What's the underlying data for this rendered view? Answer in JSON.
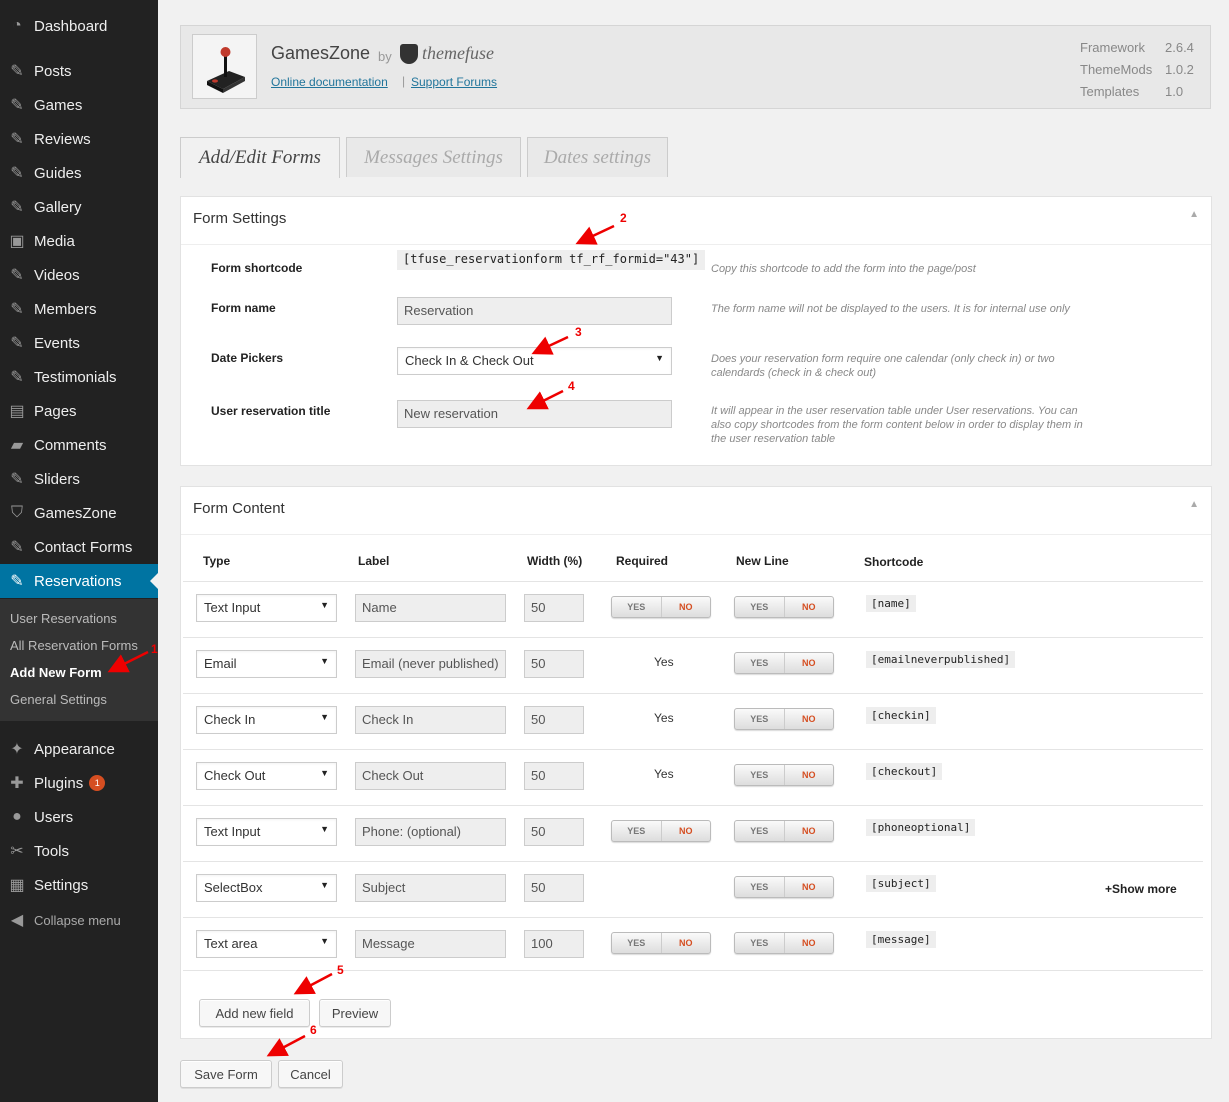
{
  "sidebar": {
    "items": [
      {
        "label": "Dashboard",
        "icon": "dashboard-icon",
        "glyph": "◔"
      },
      {
        "label": "Posts",
        "icon": "pin-icon",
        "glyph": "✎"
      },
      {
        "label": "Games",
        "icon": "pin-icon",
        "glyph": "✎"
      },
      {
        "label": "Reviews",
        "icon": "pin-icon",
        "glyph": "✎"
      },
      {
        "label": "Guides",
        "icon": "pin-icon",
        "glyph": "✎"
      },
      {
        "label": "Gallery",
        "icon": "pin-icon",
        "glyph": "✎"
      },
      {
        "label": "Media",
        "icon": "media-icon",
        "glyph": "▣"
      },
      {
        "label": "Videos",
        "icon": "pin-icon",
        "glyph": "✎"
      },
      {
        "label": "Members",
        "icon": "pin-icon",
        "glyph": "✎"
      },
      {
        "label": "Events",
        "icon": "pin-icon",
        "glyph": "✎"
      },
      {
        "label": "Testimonials",
        "icon": "pin-icon",
        "glyph": "✎"
      },
      {
        "label": "Pages",
        "icon": "pages-icon",
        "glyph": "▤"
      },
      {
        "label": "Comments",
        "icon": "comment-icon",
        "glyph": "▰"
      },
      {
        "label": "Sliders",
        "icon": "pin-icon",
        "glyph": "✎"
      },
      {
        "label": "GamesZone",
        "icon": "shield-icon",
        "glyph": "⛉"
      },
      {
        "label": "Contact Forms",
        "icon": "pin-icon",
        "glyph": "✎"
      },
      {
        "label": "Reservations",
        "icon": "pin-icon",
        "glyph": "✎"
      }
    ],
    "submenu": [
      {
        "label": "User Reservations"
      },
      {
        "label": "All Reservation Forms"
      },
      {
        "label": "Add New Form"
      },
      {
        "label": "General Settings"
      }
    ],
    "bottom_items": [
      {
        "label": "Appearance",
        "icon": "appearance-icon",
        "glyph": "✦"
      },
      {
        "label": "Plugins",
        "icon": "plugin-icon",
        "glyph": "✚",
        "badge": "1"
      },
      {
        "label": "Users",
        "icon": "user-icon",
        "glyph": "●"
      },
      {
        "label": "Tools",
        "icon": "wrench-icon",
        "glyph": "✂"
      },
      {
        "label": "Settings",
        "icon": "settings-icon",
        "glyph": "▦"
      }
    ],
    "collapse_label": "Collapse menu"
  },
  "header": {
    "app_title": "GamesZone",
    "by": "by",
    "brand": "themefuse",
    "link_docs": "Online documentation",
    "separator": "|",
    "link_forums": "Support Forums",
    "versions": [
      {
        "label": "Framework",
        "value": "2.6.4"
      },
      {
        "label": "ThemeMods",
        "value": "1.0.2"
      },
      {
        "label": "Templates",
        "value": "1.0"
      }
    ]
  },
  "tabs": [
    {
      "label": "Add/Edit Forms"
    },
    {
      "label": "Messages Settings"
    },
    {
      "label": "Dates settings"
    }
  ],
  "form_settings": {
    "title": "Form Settings",
    "toggle": "▲",
    "shortcode_label": "Form shortcode",
    "shortcode_value": "[tfuse_reservationform tf_rf_formid=\"43\"]",
    "shortcode_help": "Copy this shortcode to add the form into the page/post",
    "name_label": "Form name",
    "name_value": "Reservation",
    "name_help": "The form name will not be displayed to the users. It is for internal use only",
    "date_label": "Date Pickers",
    "date_value": "Check In & Check Out",
    "date_help": "Does your reservation form require one calendar (only check in) or two calendards (check in & check out)",
    "title_label": "User reservation title",
    "title_value": "New reservation",
    "title_help": "It will appear in the user reservation table under User reservations. You can also copy shortcodes from the form content below in order to display them in the user reservation table"
  },
  "form_content": {
    "title": "Form Content",
    "toggle": "▲",
    "headers": {
      "type": "Type",
      "label": "Label",
      "width": "Width (%)",
      "required": "Required",
      "newline": "New Line",
      "shortcode": "Shortcode"
    },
    "toggle_yes": "YES",
    "toggle_no": "NO",
    "rows": [
      {
        "type": "Text Input",
        "label": "Name",
        "width": "50",
        "required": "toggle",
        "shortcode": "[name]"
      },
      {
        "type": "Email",
        "label": "Email (never published)",
        "width": "50",
        "required": "Yes",
        "shortcode": "[emailneverpublished]"
      },
      {
        "type": "Check In",
        "label": "Check In",
        "width": "50",
        "required": "Yes",
        "shortcode": "[checkin]"
      },
      {
        "type": "Check Out",
        "label": "Check Out",
        "width": "50",
        "required": "Yes",
        "shortcode": "[checkout]"
      },
      {
        "type": "Text Input",
        "label": "Phone: (optional)",
        "width": "50",
        "required": "toggle",
        "shortcode": "[phoneoptional]"
      },
      {
        "type": "SelectBox",
        "label": "Subject",
        "width": "50",
        "required": "",
        "shortcode": "[subject]",
        "extra": "+Show more"
      },
      {
        "type": "Text area",
        "label": "Message",
        "width": "100",
        "required": "toggle",
        "shortcode": "[message]"
      }
    ],
    "add_field_label": "Add new  field",
    "preview_label": "Preview"
  },
  "actions": {
    "save_label": "Save Form",
    "cancel_label": "Cancel"
  },
  "annotations": [
    "1",
    "2",
    "3",
    "4",
    "5",
    "6"
  ],
  "colors": {
    "sidebar_bg": "#222222",
    "current_menu": "#0074a2",
    "link": "#21759b",
    "toggle_no": "#d54e21",
    "annotation": "#ee0000"
  }
}
